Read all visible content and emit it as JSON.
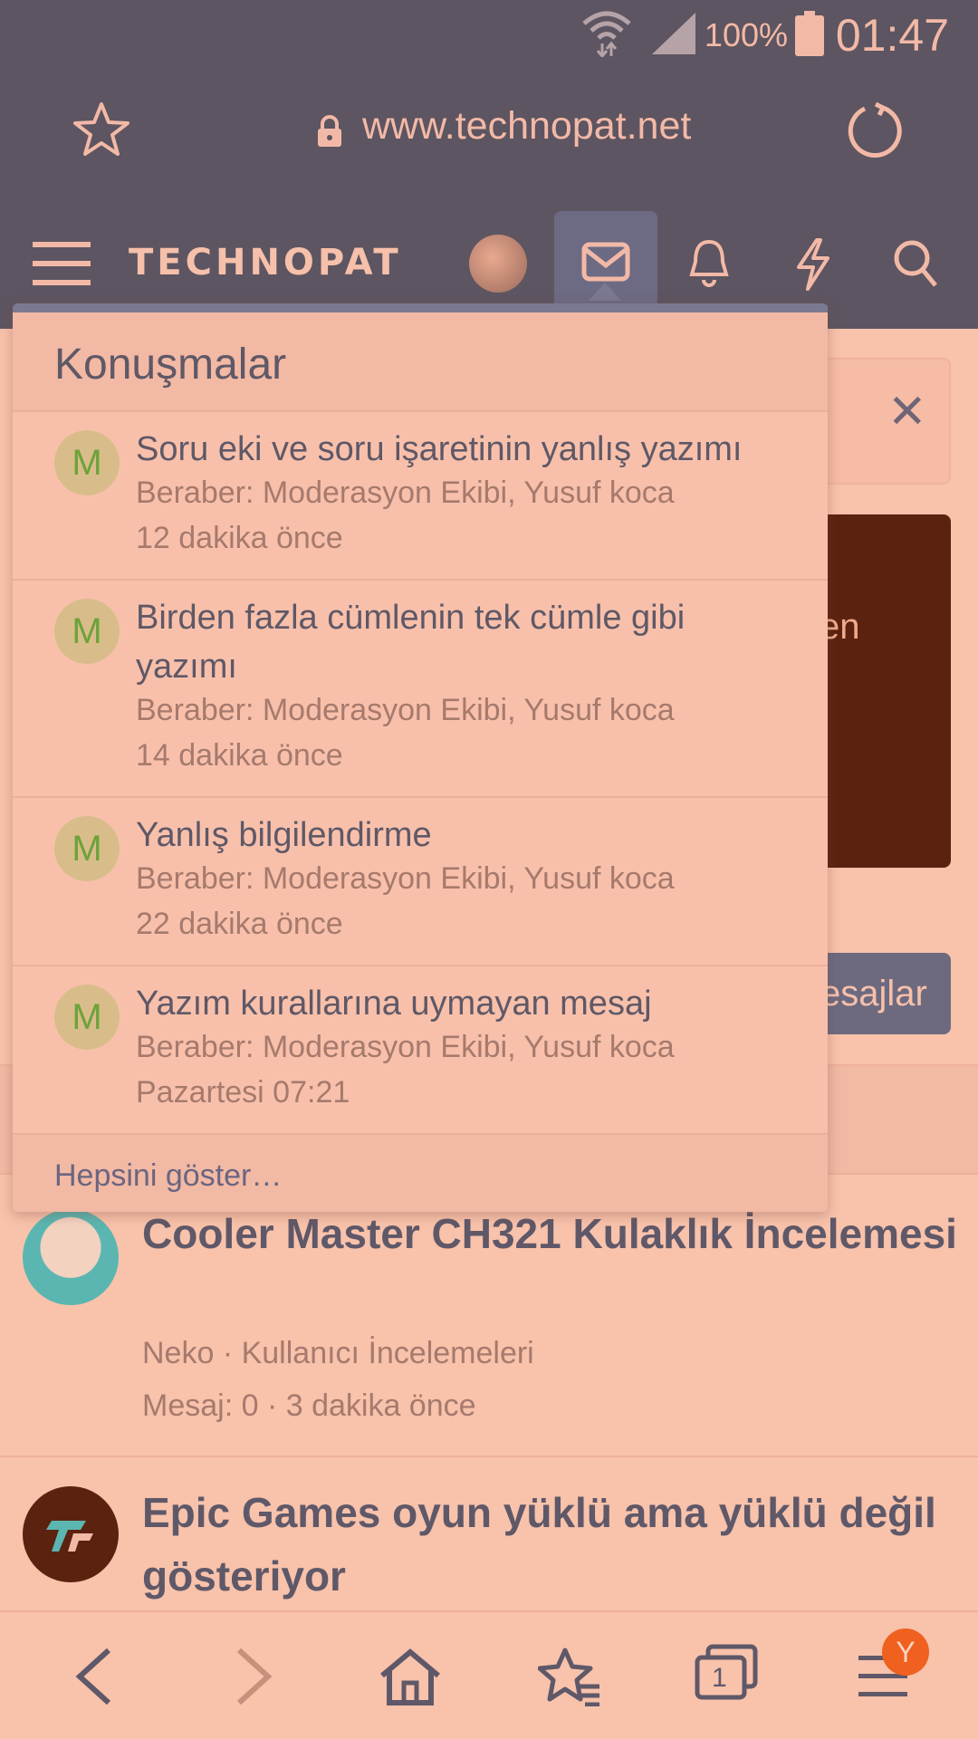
{
  "status_bar": {
    "battery": "100%",
    "time": "01:47"
  },
  "browser": {
    "url": "www.technopat.net"
  },
  "site": {
    "logo": "TECHNOPAT"
  },
  "background": {
    "dark_card_text": "en",
    "button_text": "esajlar"
  },
  "threads": [
    {
      "title": "Cooler Master CH321 Kulaklık İncelemesi",
      "meta1": "Neko · Kullanıcı İncelemeleri",
      "meta2": "Mesaj: 0 · 3 dakika önce"
    },
    {
      "title": "Epic Games oyun yüklü ama yüklü değil gösteriyor"
    }
  ],
  "popup": {
    "title": "Konuşmalar",
    "conversations": [
      {
        "avatar": "M",
        "title": "Soru eki ve soru işaretinin yanlış yazımı",
        "participants": "Beraber: Moderasyon Ekibi, Yusuf koca",
        "time": "12 dakika önce"
      },
      {
        "avatar": "M",
        "title": "Birden fazla cümlenin tek cümle gibi yazımı",
        "participants": "Beraber: Moderasyon Ekibi, Yusuf koca",
        "time": "14 dakika önce"
      },
      {
        "avatar": "M",
        "title": "Yanlış bilgilendirme",
        "participants": "Beraber: Moderasyon Ekibi, Yusuf koca",
        "time": "22 dakika önce"
      },
      {
        "avatar": "M",
        "title": "Yazım kurallarına uymayan mesaj",
        "participants": "Beraber: Moderasyon Ekibi, Yusuf koca",
        "time": "Pazartesi 07:21"
      }
    ],
    "footer": "Hepsini göster…"
  },
  "bottom_bar": {
    "tabs_count": "1",
    "menu_badge": "Y"
  },
  "icons": [
    "wifi-icon",
    "signal-icon",
    "battery-icon",
    "star-icon",
    "lock-icon",
    "reload-icon",
    "hamburger-icon",
    "envelope-icon",
    "bell-icon",
    "bolt-icon",
    "search-icon",
    "back-icon",
    "forward-icon",
    "home-icon",
    "bookmarks-icon",
    "tabs-icon",
    "menu-icon",
    "close-icon"
  ],
  "colors": {
    "header_bg": "#5d5561",
    "page_bg": "#f8c2ab",
    "accent": "#7b7891",
    "badge": "#f0601e"
  }
}
